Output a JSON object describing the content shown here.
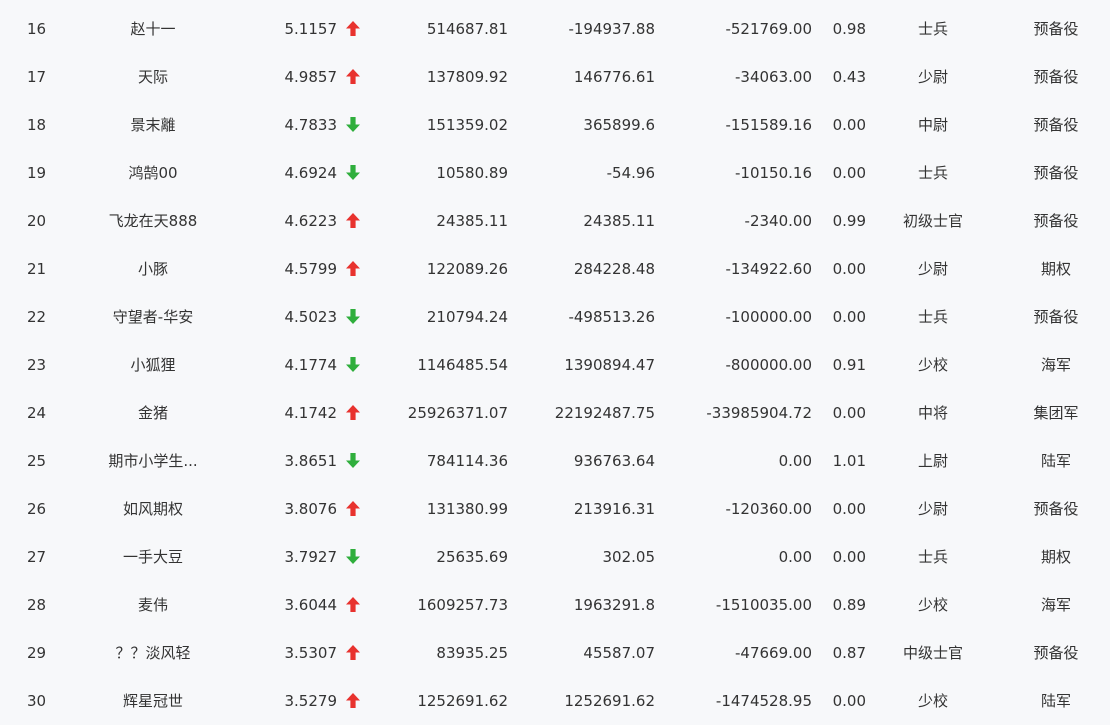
{
  "colors": {
    "up": "#e8322e",
    "down": "#2fae3c",
    "text": "#333333",
    "background": "#f7f8fa"
  },
  "rows": [
    {
      "rank": "16",
      "name": "赵十一",
      "ratio": "5.1157",
      "trend": "up",
      "trend_icon": "arrow-up-icon",
      "v1": "514687.81",
      "v2": "-194937.88",
      "v3": "-521769.00",
      "v4": "0.98",
      "military_rank": "士兵",
      "branch": "预备役"
    },
    {
      "rank": "17",
      "name": "天际",
      "ratio": "4.9857",
      "trend": "up",
      "trend_icon": "arrow-up-icon",
      "v1": "137809.92",
      "v2": "146776.61",
      "v3": "-34063.00",
      "v4": "0.43",
      "military_rank": "少尉",
      "branch": "预备役"
    },
    {
      "rank": "18",
      "name": "景末離",
      "ratio": "4.7833",
      "trend": "down",
      "trend_icon": "arrow-down-icon",
      "v1": "151359.02",
      "v2": "365899.6",
      "v3": "-151589.16",
      "v4": "0.00",
      "military_rank": "中尉",
      "branch": "预备役"
    },
    {
      "rank": "19",
      "name": "鸿鹄00",
      "ratio": "4.6924",
      "trend": "down",
      "trend_icon": "arrow-down-icon",
      "v1": "10580.89",
      "v2": "-54.96",
      "v3": "-10150.16",
      "v4": "0.00",
      "military_rank": "士兵",
      "branch": "预备役"
    },
    {
      "rank": "20",
      "name": "飞龙在天888",
      "ratio": "4.6223",
      "trend": "up",
      "trend_icon": "arrow-up-icon",
      "v1": "24385.11",
      "v2": "24385.11",
      "v3": "-2340.00",
      "v4": "0.99",
      "military_rank": "初级士官",
      "branch": "预备役"
    },
    {
      "rank": "21",
      "name": "小豚",
      "ratio": "4.5799",
      "trend": "up",
      "trend_icon": "arrow-up-icon",
      "v1": "122089.26",
      "v2": "284228.48",
      "v3": "-134922.60",
      "v4": "0.00",
      "military_rank": "少尉",
      "branch": "期权"
    },
    {
      "rank": "22",
      "name": "守望者-华安",
      "ratio": "4.5023",
      "trend": "down",
      "trend_icon": "arrow-down-icon",
      "v1": "210794.24",
      "v2": "-498513.26",
      "v3": "-100000.00",
      "v4": "0.00",
      "military_rank": "士兵",
      "branch": "预备役"
    },
    {
      "rank": "23",
      "name": "小狐狸",
      "ratio": "4.1774",
      "trend": "down",
      "trend_icon": "arrow-down-icon",
      "v1": "1146485.54",
      "v2": "1390894.47",
      "v3": "-800000.00",
      "v4": "0.91",
      "military_rank": "少校",
      "branch": "海军"
    },
    {
      "rank": "24",
      "name": "金猪",
      "ratio": "4.1742",
      "trend": "up",
      "trend_icon": "arrow-up-icon",
      "v1": "25926371.07",
      "v2": "22192487.75",
      "v3": "-33985904.72",
      "v4": "0.00",
      "military_rank": "中将",
      "branch": "集团军"
    },
    {
      "rank": "25",
      "name": "期市小学生...",
      "ratio": "3.8651",
      "trend": "down",
      "trend_icon": "arrow-down-icon",
      "v1": "784114.36",
      "v2": "936763.64",
      "v3": "0.00",
      "v4": "1.01",
      "military_rank": "上尉",
      "branch": "陆军"
    },
    {
      "rank": "26",
      "name": "如风期权",
      "ratio": "3.8076",
      "trend": "up",
      "trend_icon": "arrow-up-icon",
      "v1": "131380.99",
      "v2": "213916.31",
      "v3": "-120360.00",
      "v4": "0.00",
      "military_rank": "少尉",
      "branch": "预备役"
    },
    {
      "rank": "27",
      "name": "一手大豆",
      "ratio": "3.7927",
      "trend": "down",
      "trend_icon": "arrow-down-icon",
      "v1": "25635.69",
      "v2": "302.05",
      "v3": "0.00",
      "v4": "0.00",
      "military_rank": "士兵",
      "branch": "期权"
    },
    {
      "rank": "28",
      "name": "麦伟",
      "ratio": "3.6044",
      "trend": "up",
      "trend_icon": "arrow-up-icon",
      "v1": "1609257.73",
      "v2": "1963291.8",
      "v3": "-1510035.00",
      "v4": "0.89",
      "military_rank": "少校",
      "branch": "海军"
    },
    {
      "rank": "29",
      "name": "？？淡风轻",
      "ratio": "3.5307",
      "trend": "up",
      "trend_icon": "arrow-up-icon",
      "v1": "83935.25",
      "v2": "45587.07",
      "v3": "-47669.00",
      "v4": "0.87",
      "military_rank": "中级士官",
      "branch": "预备役"
    },
    {
      "rank": "30",
      "name": "辉星冠世",
      "ratio": "3.5279",
      "trend": "up",
      "trend_icon": "arrow-up-icon",
      "v1": "1252691.62",
      "v2": "1252691.62",
      "v3": "-1474528.95",
      "v4": "0.00",
      "military_rank": "少校",
      "branch": "陆军"
    }
  ]
}
